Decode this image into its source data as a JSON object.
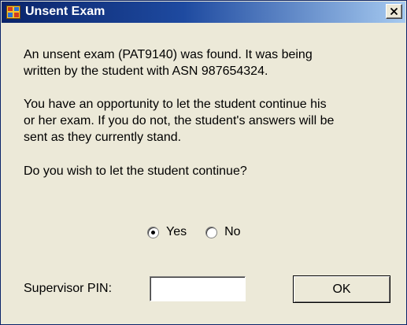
{
  "window": {
    "title": "Unsent Exam",
    "close_glyph": "close-icon",
    "icon": "app-window-icon"
  },
  "message": {
    "paragraph_1_line_1": "An unsent exam (PAT9140) was found. It was being",
    "paragraph_1_line_2": "written by the student with ASN 987654324.",
    "paragraph_2_line_1": "You have an opportunity to let the student continue his",
    "paragraph_2_line_2": "or her exam. If you do not, the student's answers will be",
    "paragraph_2_line_3": "sent as they currently stand.",
    "question": "Do you wish to let the student continue?"
  },
  "choice": {
    "options": [
      {
        "label": "Yes",
        "selected": true
      },
      {
        "label": "No",
        "selected": false
      }
    ]
  },
  "pin": {
    "label": "Supervisor PIN:",
    "value": ""
  },
  "buttons": {
    "ok_label": "OK"
  },
  "colors": {
    "dialog_background": "#ece9d8",
    "titlebar_start": "#0a246a",
    "titlebar_end": "#a6caf0",
    "title_text": "#ffffff"
  }
}
